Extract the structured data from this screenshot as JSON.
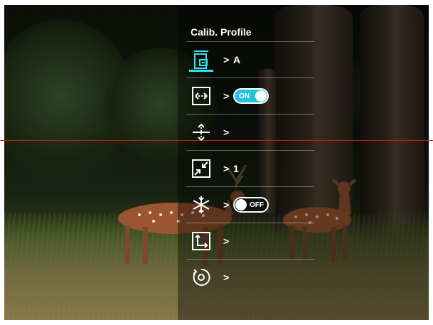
{
  "menu": {
    "title": "Calib. Profile",
    "chevron": ">",
    "items": [
      {
        "icon": "calibration-profile-icon",
        "value": "A",
        "selected": true
      },
      {
        "icon": "horizontal-expand-icon",
        "toggle": "ON",
        "toggle_state": "on"
      },
      {
        "icon": "vertical-adjust-icon",
        "value": ""
      },
      {
        "icon": "zoom-shrink-icon",
        "value": "1"
      },
      {
        "icon": "freeze-icon",
        "toggle": "OFF",
        "toggle_state": "off"
      },
      {
        "icon": "axis-position-icon",
        "value": ""
      },
      {
        "icon": "reset-icon",
        "value": ""
      }
    ]
  },
  "colors": {
    "accent": "#2ee6f2",
    "toggle_on": "#21c4dc",
    "reticle_line": "#d01818"
  }
}
